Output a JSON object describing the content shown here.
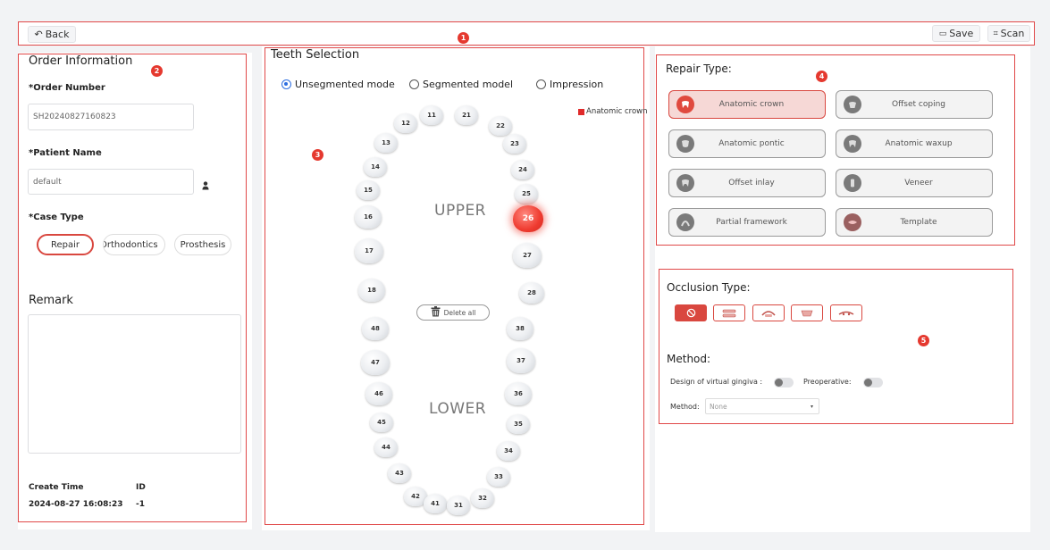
{
  "toolbar": {
    "back_label": "Back",
    "save_label": "Save",
    "scan_label": "Scan"
  },
  "badges": [
    "1",
    "2",
    "3",
    "4",
    "5"
  ],
  "order": {
    "title": "Order Information",
    "order_number_label": "*Order Number",
    "order_number_value": "SH20240827160823",
    "patient_name_label": "*Patient Name",
    "patient_name_value": "default",
    "case_type_label": "*Case Type",
    "case_types": [
      "Repair",
      "Orthodontics",
      "Prosthesis"
    ],
    "remark_label": "Remark",
    "create_time_label": "Create Time",
    "create_time_value": "2024-08-27 16:08:23",
    "id_label": "ID",
    "id_value": "-1"
  },
  "teeth": {
    "title": "Teeth Selection",
    "modes": [
      "Unsegmented mode",
      "Segmented model",
      "Impression"
    ],
    "selected_mode": "Unsegmented mode",
    "legend": "Anatomic crown",
    "legend_color": "#e02a2a",
    "upper_label": "UPPER",
    "lower_label": "LOWER",
    "delete_all_label": "Delete all",
    "selected_tooth": "26",
    "upper": [
      "11",
      "21",
      "12",
      "22",
      "13",
      "23",
      "14",
      "24",
      "15",
      "25",
      "16",
      "26",
      "17",
      "27",
      "18",
      "28"
    ],
    "lower": [
      "48",
      "38",
      "47",
      "37",
      "46",
      "36",
      "45",
      "35",
      "44",
      "34",
      "43",
      "33",
      "42",
      "32",
      "41",
      "31"
    ]
  },
  "repair": {
    "title": "Repair Type:",
    "items": [
      "Anatomic crown",
      "Offset coping",
      "Anatomic pontic",
      "Anatomic waxup",
      "Offset inlay",
      "Veneer",
      "Partial framework",
      "Template"
    ],
    "selected": "Anatomic crown"
  },
  "occlusion": {
    "title": "Occlusion Type:",
    "icons": [
      "no-occlusion-icon",
      "full-arch-occlusion-icon",
      "antagonist-occlusion-icon",
      "bite-occlusion-icon",
      "partial-arch-occlusion-icon"
    ],
    "method_title": "Method:",
    "gingiva_label": "Design of virtual gingiva :",
    "preop_label": "Preoperative:",
    "method_label": "Method:",
    "method_value": "None"
  },
  "colors": {
    "accent": "#d9473f",
    "badge": "#e5392f",
    "radio": "#2d6ee0"
  }
}
